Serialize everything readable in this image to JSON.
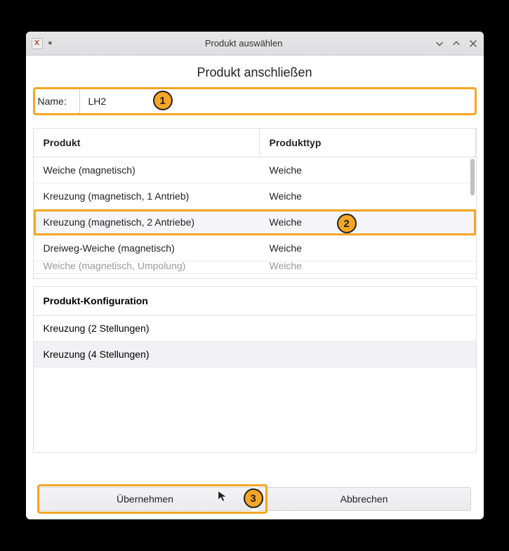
{
  "window": {
    "title": "Produkt auswählen"
  },
  "section_title": "Produkt anschließen",
  "name_field": {
    "label": "Name:",
    "value": "LH2"
  },
  "product_table": {
    "headers": {
      "product": "Produkt",
      "product_type": "Produkttyp"
    },
    "rows": [
      {
        "product": "Weiche (magnetisch)",
        "type": "Weiche"
      },
      {
        "product": "Kreuzung (magnetisch, 1 Antrieb)",
        "type": "Weiche"
      },
      {
        "product": "Kreuzung (magnetisch, 2 Antriebe)",
        "type": "Weiche"
      },
      {
        "product": "Dreiweg-Weiche (magnetisch)",
        "type": "Weiche"
      },
      {
        "product": "Weiche (magnetisch, Umpolung)",
        "type": "Weiche"
      }
    ]
  },
  "config": {
    "header": "Produkt-Konfiguration",
    "rows": [
      "Kreuzung (2 Stellungen)",
      "Kreuzung (4 Stellungen)"
    ]
  },
  "buttons": {
    "apply": "Übernehmen",
    "cancel": "Abbrechen"
  },
  "annotations": {
    "badge1": "1",
    "badge2": "2",
    "badge3": "3"
  }
}
